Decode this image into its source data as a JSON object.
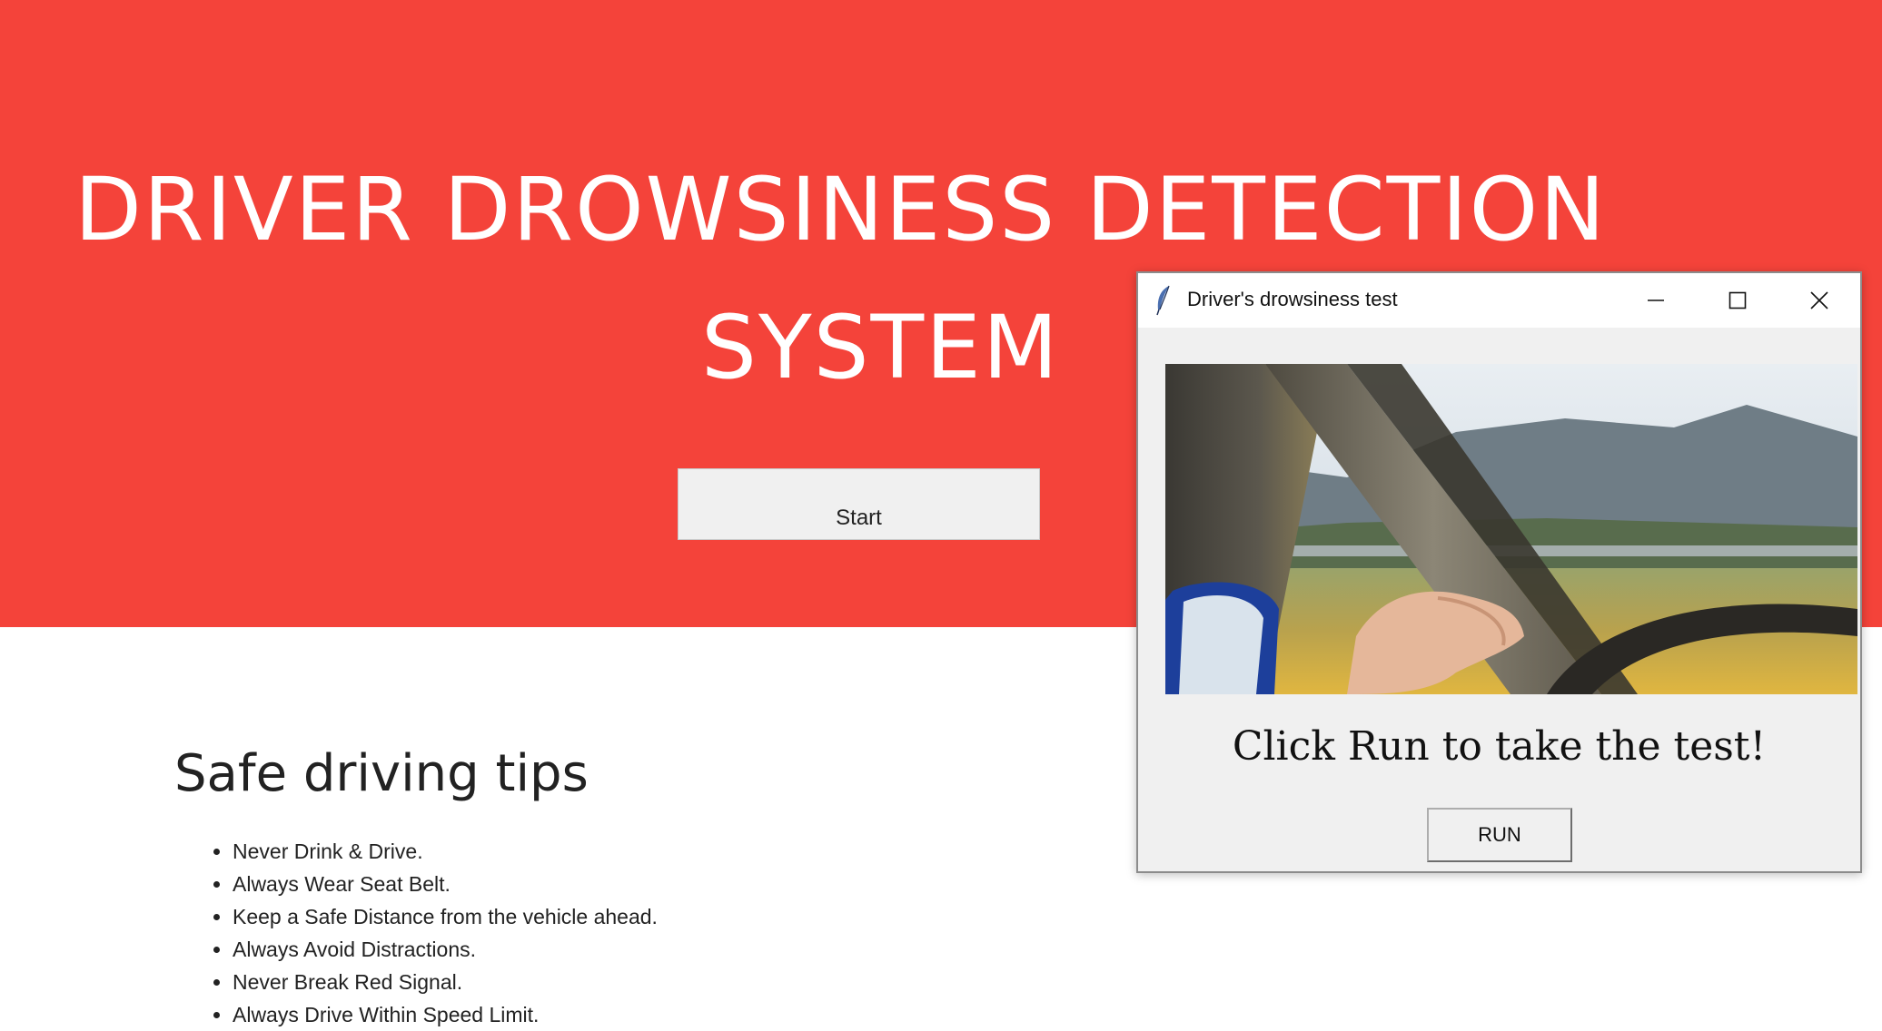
{
  "page": {
    "hero": {
      "title_line1": "DRIVER DROWSINESS DETECTION",
      "title_line2": "SYSTEM",
      "start_label": "Start",
      "bg_color": "#f4433a"
    },
    "tips": {
      "heading": "Safe driving tips",
      "items": [
        "Never Drink & Drive.",
        "Always Wear Seat Belt.",
        "Keep a Safe Distance from the vehicle ahead.",
        "Always Avoid Distractions.",
        "Never Break Red Signal.",
        "Always Drive Within Speed Limit."
      ]
    }
  },
  "dialog": {
    "title": "Driver's drowsiness test",
    "app_icon": "feather-icon",
    "controls": [
      "minimize-icon",
      "maximize-icon",
      "close-icon"
    ],
    "prompt": "Click Run to take the test!",
    "run_label": "RUN"
  }
}
